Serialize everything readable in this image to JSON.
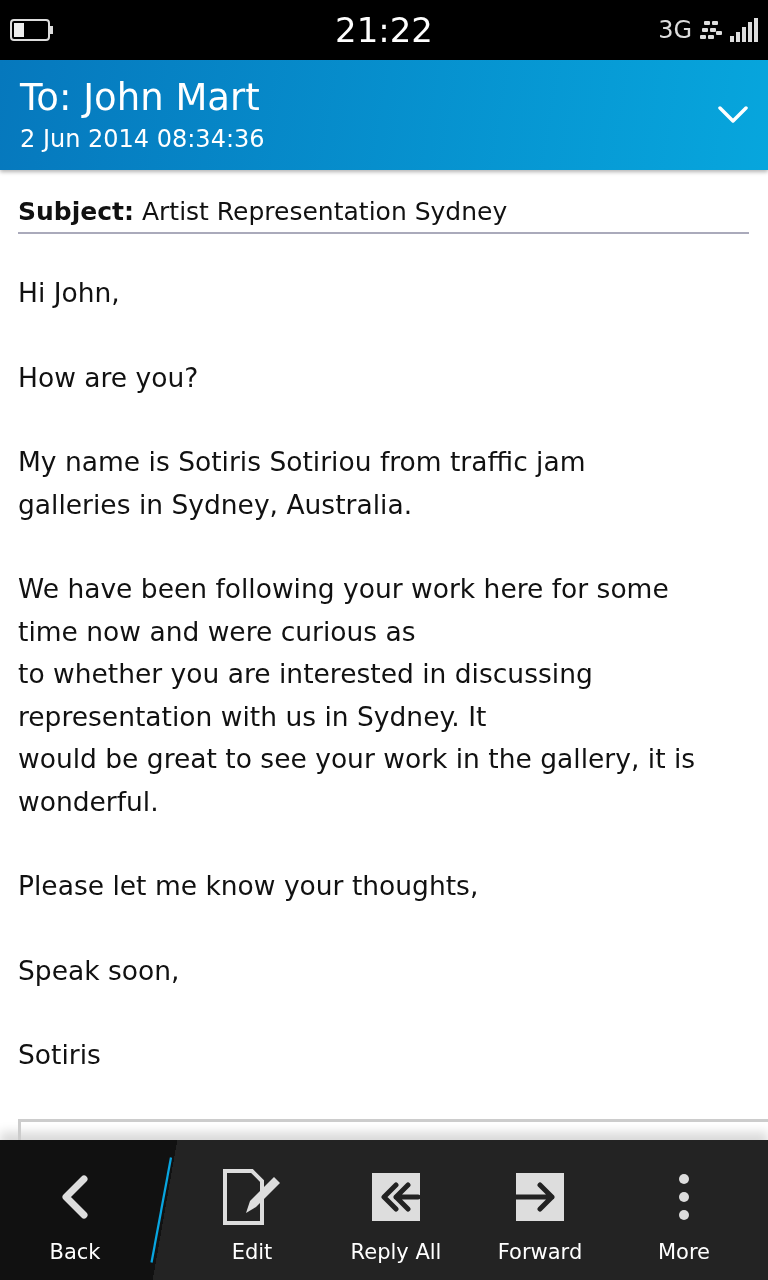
{
  "status_bar": {
    "time": "21:22",
    "network": "3G"
  },
  "header": {
    "title": "To: John Mart",
    "date": "2 Jun 2014 08:34:36"
  },
  "message": {
    "subject_label": "Subject:",
    "subject": "Artist Representation Sydney",
    "paragraphs": [
      {
        "lines": [
          "Hi John,"
        ]
      },
      {
        "lines": [
          "How are you?"
        ]
      },
      {
        "lines": [
          "My name is Sotiris Sotiriou from traffic jam",
          "galleries in Sydney, Australia."
        ]
      },
      {
        "lines": [
          "We have been following your work here for some",
          "time now and were curious as",
          "to whether you are interested in discussing",
          "representation with us in Sydney. It",
          "would be great to see your work in the gallery, it is",
          "wonderful."
        ]
      },
      {
        "lines": [
          "Please let me know your thoughts,"
        ]
      },
      {
        "lines": [
          "Speak soon,"
        ]
      },
      {
        "lines": [
          "Sotiris"
        ]
      }
    ]
  },
  "action_bar": [
    {
      "kind": "back",
      "label": "Back"
    },
    {
      "kind": "edit",
      "label": "Edit"
    },
    {
      "kind": "reply_all",
      "label": "Reply All"
    },
    {
      "kind": "forward",
      "label": "Forward"
    },
    {
      "kind": "more",
      "label": "More"
    }
  ]
}
